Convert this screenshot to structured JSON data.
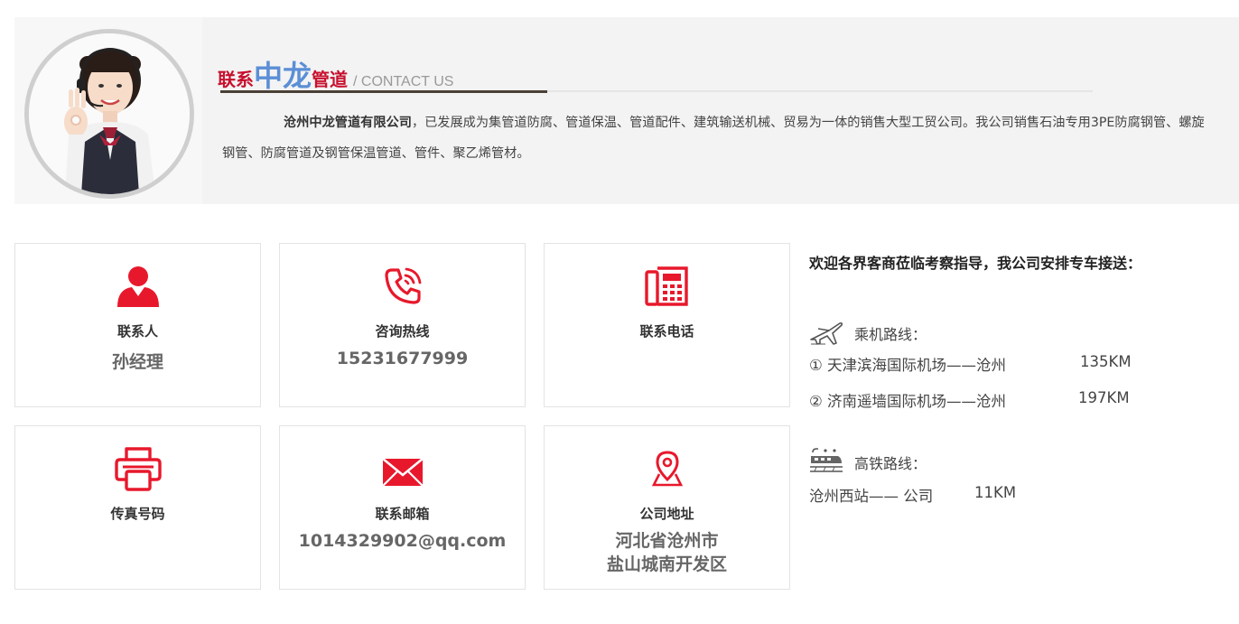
{
  "header": {
    "title_part1": "联系",
    "title_part2": "中龙",
    "title_part3": "管道",
    "title_sub": "/ CONTACT US"
  },
  "intro": {
    "company": "沧州中龙管道有限公司",
    "text": "，已发展成为集管道防腐、管道保温、管道配件、建筑输送机械、贸易为一体的销售大型工贸公司。我公司销售石油专用3PE防腐钢管、螺旋钢管、防腐管道及钢管保温管道、管件、聚乙烯管材。"
  },
  "boxes": [
    {
      "label": "联系人",
      "value": "孙经理",
      "icon": "person-icon"
    },
    {
      "label": "咨询热线",
      "value": "15231677999",
      "icon": "phone-call-icon"
    },
    {
      "label": "联系电话",
      "value": "",
      "icon": "desk-phone-icon"
    },
    {
      "label": "传真号码",
      "value": "",
      "icon": "printer-icon"
    },
    {
      "label": "联系邮箱",
      "value": "1014329902@qq.com",
      "icon": "mail-icon"
    },
    {
      "label": "公司地址",
      "value_line1": "河北省沧州市",
      "value_line2": "盐山城南开发区",
      "icon": "location-pin-icon"
    }
  ],
  "routes": {
    "welcome": "欢迎各界客商莅临考察指导，我公司安排专车接送：",
    "plane_title": "乘机路线：",
    "plane": [
      {
        "route": "① 天津滨海国际机场——沧州",
        "km": "135KM"
      },
      {
        "route": "② 济南遥墙国际机场——沧州",
        "km": "197KM"
      }
    ],
    "train_title": "高铁路线：",
    "train": [
      {
        "route": "沧州西站—— 公司",
        "km": "11KM"
      }
    ]
  },
  "colors": {
    "accent_red": "#e8182c",
    "title_red": "#c8102e",
    "title_blue": "#5b8fd6",
    "banner_bg": "#f3f3f3"
  }
}
